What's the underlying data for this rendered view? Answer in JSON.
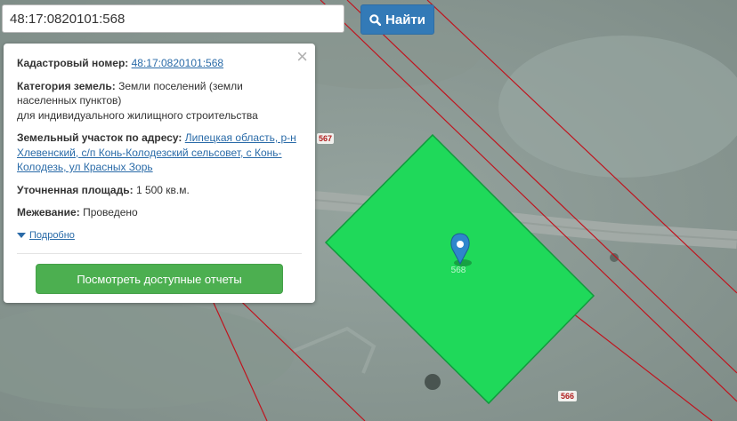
{
  "search": {
    "value": "48:17:0820101:568",
    "button_label": "Найти"
  },
  "popup": {
    "cadastral_label": "Кадастровый номер:",
    "cadastral_value": "48:17:0820101:568",
    "category_label": "Категория земель:",
    "category_value_line1": "Земли поселений (земли",
    "category_value_line2": "населенных пунктов)",
    "category_value_line3": "для индивидуального жилищного строительства",
    "address_label": "Земельный участок по адресу:",
    "address_part1": "Липецкая область, р-н",
    "address_part2": "Хлевенский, с/п Конь-Колодезский сельсовет, с Конь-",
    "address_part3": "Колодезь, ул Красных Зорь",
    "area_label": "Уточненная площадь:",
    "area_value": "1 500 кв.м.",
    "survey_label": "Межевание:",
    "survey_value": "Проведено",
    "more_link": "Подробно",
    "reports_button": "Посмотреть доступные отчеты",
    "close": "×"
  },
  "map": {
    "parcel_labels": [
      "567",
      "566"
    ],
    "marker_label": "568",
    "parcel_color": "#1fd95a",
    "boundary_color": "#c0141e"
  }
}
